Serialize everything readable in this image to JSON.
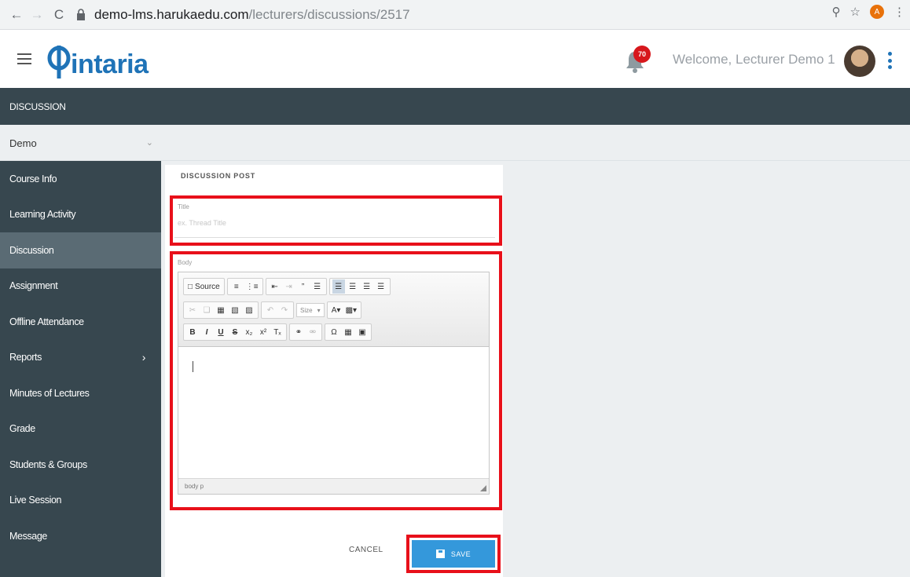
{
  "browser": {
    "back": "←",
    "forward": "→",
    "reload": "C",
    "url_host": "demo-lms.harukaedu.com",
    "url_path": "/lecturers/discussions/2517",
    "profile_initial": "A"
  },
  "header": {
    "logo_text": "intaria",
    "notification_count": "70",
    "welcome_text": "Welcome, Lecturer Demo 1"
  },
  "section": {
    "title": "DISCUSSION"
  },
  "course_selector": {
    "value": "Demo"
  },
  "sidebar": {
    "items": [
      {
        "label": "Course Info"
      },
      {
        "label": "Learning Activity"
      },
      {
        "label": "Discussion"
      },
      {
        "label": "Assignment"
      },
      {
        "label": "Offline Attendance"
      },
      {
        "label": "Reports"
      },
      {
        "label": "Minutes of Lectures"
      },
      {
        "label": "Grade"
      },
      {
        "label": "Students & Groups"
      },
      {
        "label": "Live Session"
      },
      {
        "label": "Message"
      }
    ]
  },
  "form": {
    "card_title": "DISCUSSION POST",
    "title_label": "Title",
    "title_placeholder": "ex. Thread Title",
    "body_label": "Body",
    "editor": {
      "source_label": "Source",
      "styles_label": "Size",
      "footer_path": "body  p"
    },
    "cancel_label": "CANCEL",
    "save_label": "SAVE"
  },
  "colors": {
    "sidebar_bg": "#37474f",
    "accent": "#3498db",
    "highlight": "#e8101a",
    "logo": "#1f73b7"
  }
}
